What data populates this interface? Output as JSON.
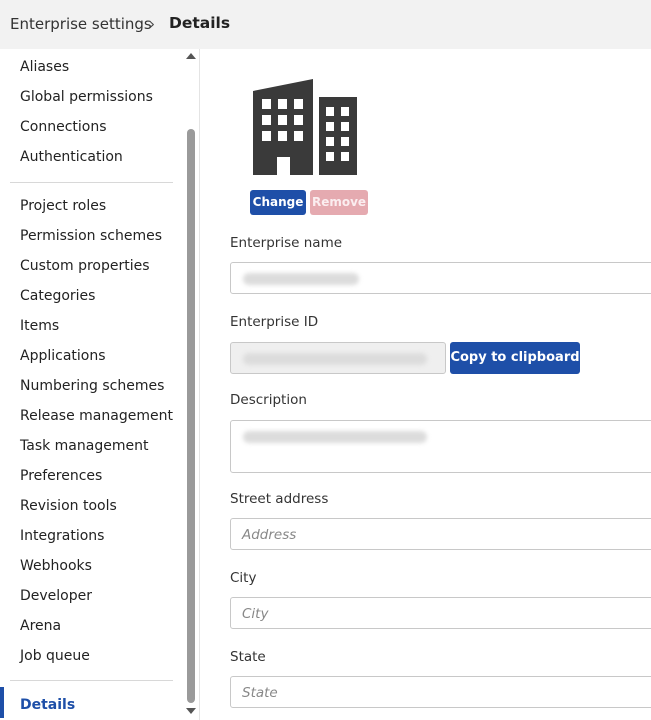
{
  "breadcrumb": {
    "parent": "Enterprise settings",
    "separator": "›",
    "current": "Details"
  },
  "sidebar": {
    "items": [
      {
        "label": "Aliases"
      },
      {
        "label": "Global permissions"
      },
      {
        "label": "Connections"
      },
      {
        "label": "Authentication"
      },
      {
        "label": "Project roles"
      },
      {
        "label": "Permission schemes"
      },
      {
        "label": "Custom properties"
      },
      {
        "label": "Categories"
      },
      {
        "label": "Items"
      },
      {
        "label": "Applications"
      },
      {
        "label": "Numbering schemes"
      },
      {
        "label": "Release management"
      },
      {
        "label": "Task management"
      },
      {
        "label": "Preferences"
      },
      {
        "label": "Revision tools"
      },
      {
        "label": "Integrations"
      },
      {
        "label": "Webhooks"
      },
      {
        "label": "Developer"
      },
      {
        "label": "Arena"
      },
      {
        "label": "Job queue"
      },
      {
        "label": "Details",
        "active": true
      }
    ]
  },
  "logo": {
    "icon": "building-icon"
  },
  "buttons": {
    "change": "Change",
    "remove": "Remove",
    "copy": "Copy to clipboard"
  },
  "form": {
    "enterprise_name": {
      "label": "Enterprise name"
    },
    "enterprise_id": {
      "label": "Enterprise ID"
    },
    "description": {
      "label": "Description"
    },
    "street_address": {
      "label": "Street address",
      "placeholder": "Address"
    },
    "city": {
      "label": "City",
      "placeholder": "City"
    },
    "state": {
      "label": "State",
      "placeholder": "State"
    }
  },
  "colors": {
    "accent": "#1e4fa8",
    "remove_disabled": "#e5aab0",
    "header_bg": "#f2f2f2"
  }
}
